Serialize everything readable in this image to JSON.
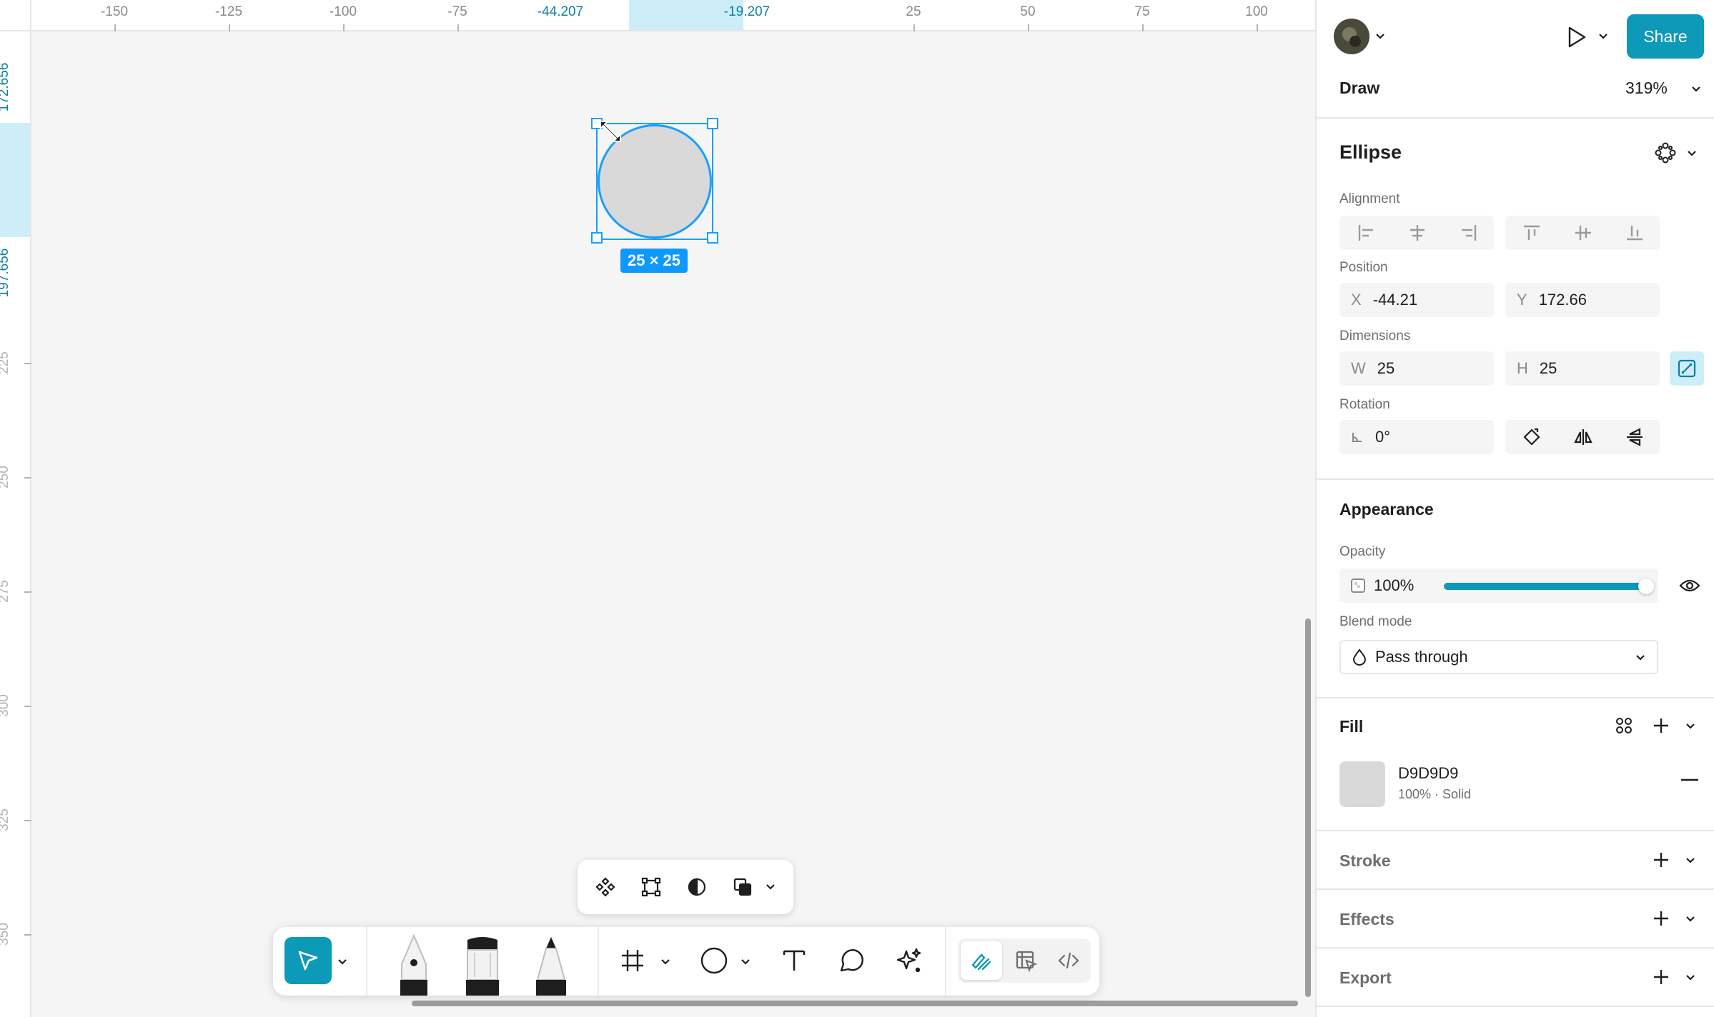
{
  "ruler": {
    "top_ticks": [
      "-150",
      "-125",
      "-100",
      "-75",
      "-44.207",
      "-19.207",
      "25",
      "50",
      "75",
      "100"
    ],
    "left_ticks": [
      "172.656",
      "197.656",
      "225",
      "250",
      "275",
      "300",
      "325",
      "350"
    ]
  },
  "canvas": {
    "size_badge": "25 × 25"
  },
  "header": {
    "share_label": "Share"
  },
  "mode": {
    "label": "Draw",
    "zoom": "319%"
  },
  "layer": {
    "name": "Ellipse"
  },
  "alignment": {
    "label": "Alignment"
  },
  "position": {
    "label": "Position",
    "x_prefix": "X",
    "x_value": "-44.21",
    "y_prefix": "Y",
    "y_value": "172.66"
  },
  "dimensions": {
    "label": "Dimensions",
    "w_prefix": "W",
    "w_value": "25",
    "h_prefix": "H",
    "h_value": "25"
  },
  "rotation": {
    "label": "Rotation",
    "value": "0°"
  },
  "appearance": {
    "title": "Appearance",
    "opacity_label": "Opacity",
    "opacity_value": "100%",
    "opacity_fraction": 1.0,
    "blend_label": "Blend mode",
    "blend_value": "Pass through"
  },
  "fill": {
    "title": "Fill",
    "hex": "D9D9D9",
    "detail": "100% · Solid",
    "color": "#d9d9d9"
  },
  "stroke": {
    "title": "Stroke"
  },
  "effects": {
    "title": "Effects"
  },
  "export": {
    "title": "Export"
  },
  "colors": {
    "accent": "#0d99b8",
    "selection": "#18a0fb"
  },
  "icons": {
    "context_bar": [
      "component-icon",
      "transform-icon",
      "mask-icon",
      "boolean-icon",
      "chevron-down-icon"
    ],
    "toolbar": [
      "move-tool-icon",
      "pen-icon",
      "marker-icon",
      "pencil-icon",
      "frame-icon",
      "ellipse-icon",
      "text-icon",
      "comment-icon",
      "ai-actions-icon",
      "draw-mode-icon",
      "design-mode-icon",
      "dev-mode-icon"
    ]
  }
}
